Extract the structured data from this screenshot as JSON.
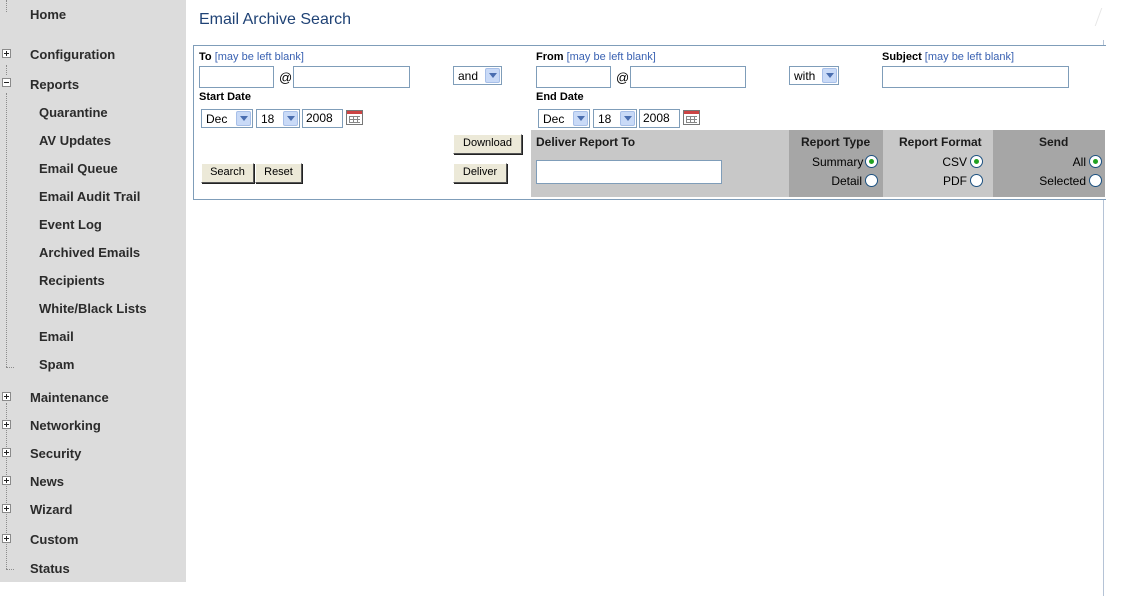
{
  "sidebar": {
    "items": [
      {
        "label": "Home",
        "expander": "none"
      },
      {
        "label": "Configuration",
        "expander": "plus"
      },
      {
        "label": "Reports",
        "expander": "minus"
      },
      {
        "label": "Quarantine"
      },
      {
        "label": "AV Updates"
      },
      {
        "label": "Email Queue"
      },
      {
        "label": "Email Audit Trail"
      },
      {
        "label": "Event Log"
      },
      {
        "label": "Archived Emails"
      },
      {
        "label": "Recipients"
      },
      {
        "label": "White/Black Lists"
      },
      {
        "label": "Email"
      },
      {
        "label": "Spam"
      },
      {
        "label": "Maintenance",
        "expander": "plus"
      },
      {
        "label": "Networking",
        "expander": "plus"
      },
      {
        "label": "Security",
        "expander": "plus"
      },
      {
        "label": "News",
        "expander": "plus"
      },
      {
        "label": "Wizard",
        "expander": "plus"
      },
      {
        "label": "Custom",
        "expander": "plus"
      },
      {
        "label": "Status",
        "expander": "none"
      }
    ]
  },
  "page": {
    "title": "Email Archive Search"
  },
  "form": {
    "to_label": "To",
    "from_label": "From",
    "subject_label": "Subject",
    "hint": "[may be left blank]",
    "at_sign": "@",
    "to_user": "",
    "to_domain": "",
    "from_user": "",
    "from_domain": "",
    "subject_value": "",
    "and_select": "and",
    "with_select": "with",
    "start_date_label": "Start Date",
    "end_date_label": "End Date",
    "start_month": "Dec",
    "start_day": "18",
    "start_year": "2008",
    "end_month": "Dec",
    "end_day": "18",
    "end_year": "2008"
  },
  "actions": {
    "search": "Search",
    "reset": "Reset",
    "download": "Download",
    "deliver": "Deliver"
  },
  "report": {
    "deliver_to_label": "Deliver Report To",
    "deliver_to_value": "",
    "type_header": "Report Type",
    "format_header": "Report Format",
    "send_header": "Send",
    "type_options": [
      {
        "label": "Summary",
        "checked": true
      },
      {
        "label": "Detail",
        "checked": false
      }
    ],
    "format_options": [
      {
        "label": "CSV",
        "checked": true
      },
      {
        "label": "PDF",
        "checked": false
      }
    ],
    "send_options": [
      {
        "label": "All",
        "checked": true
      },
      {
        "label": "Selected",
        "checked": false
      }
    ]
  },
  "colors": {
    "title": "#1f4275",
    "sidebar_bg": "#dcdcdc",
    "hint": "#3a62b2",
    "radio_on": "#21a121"
  }
}
